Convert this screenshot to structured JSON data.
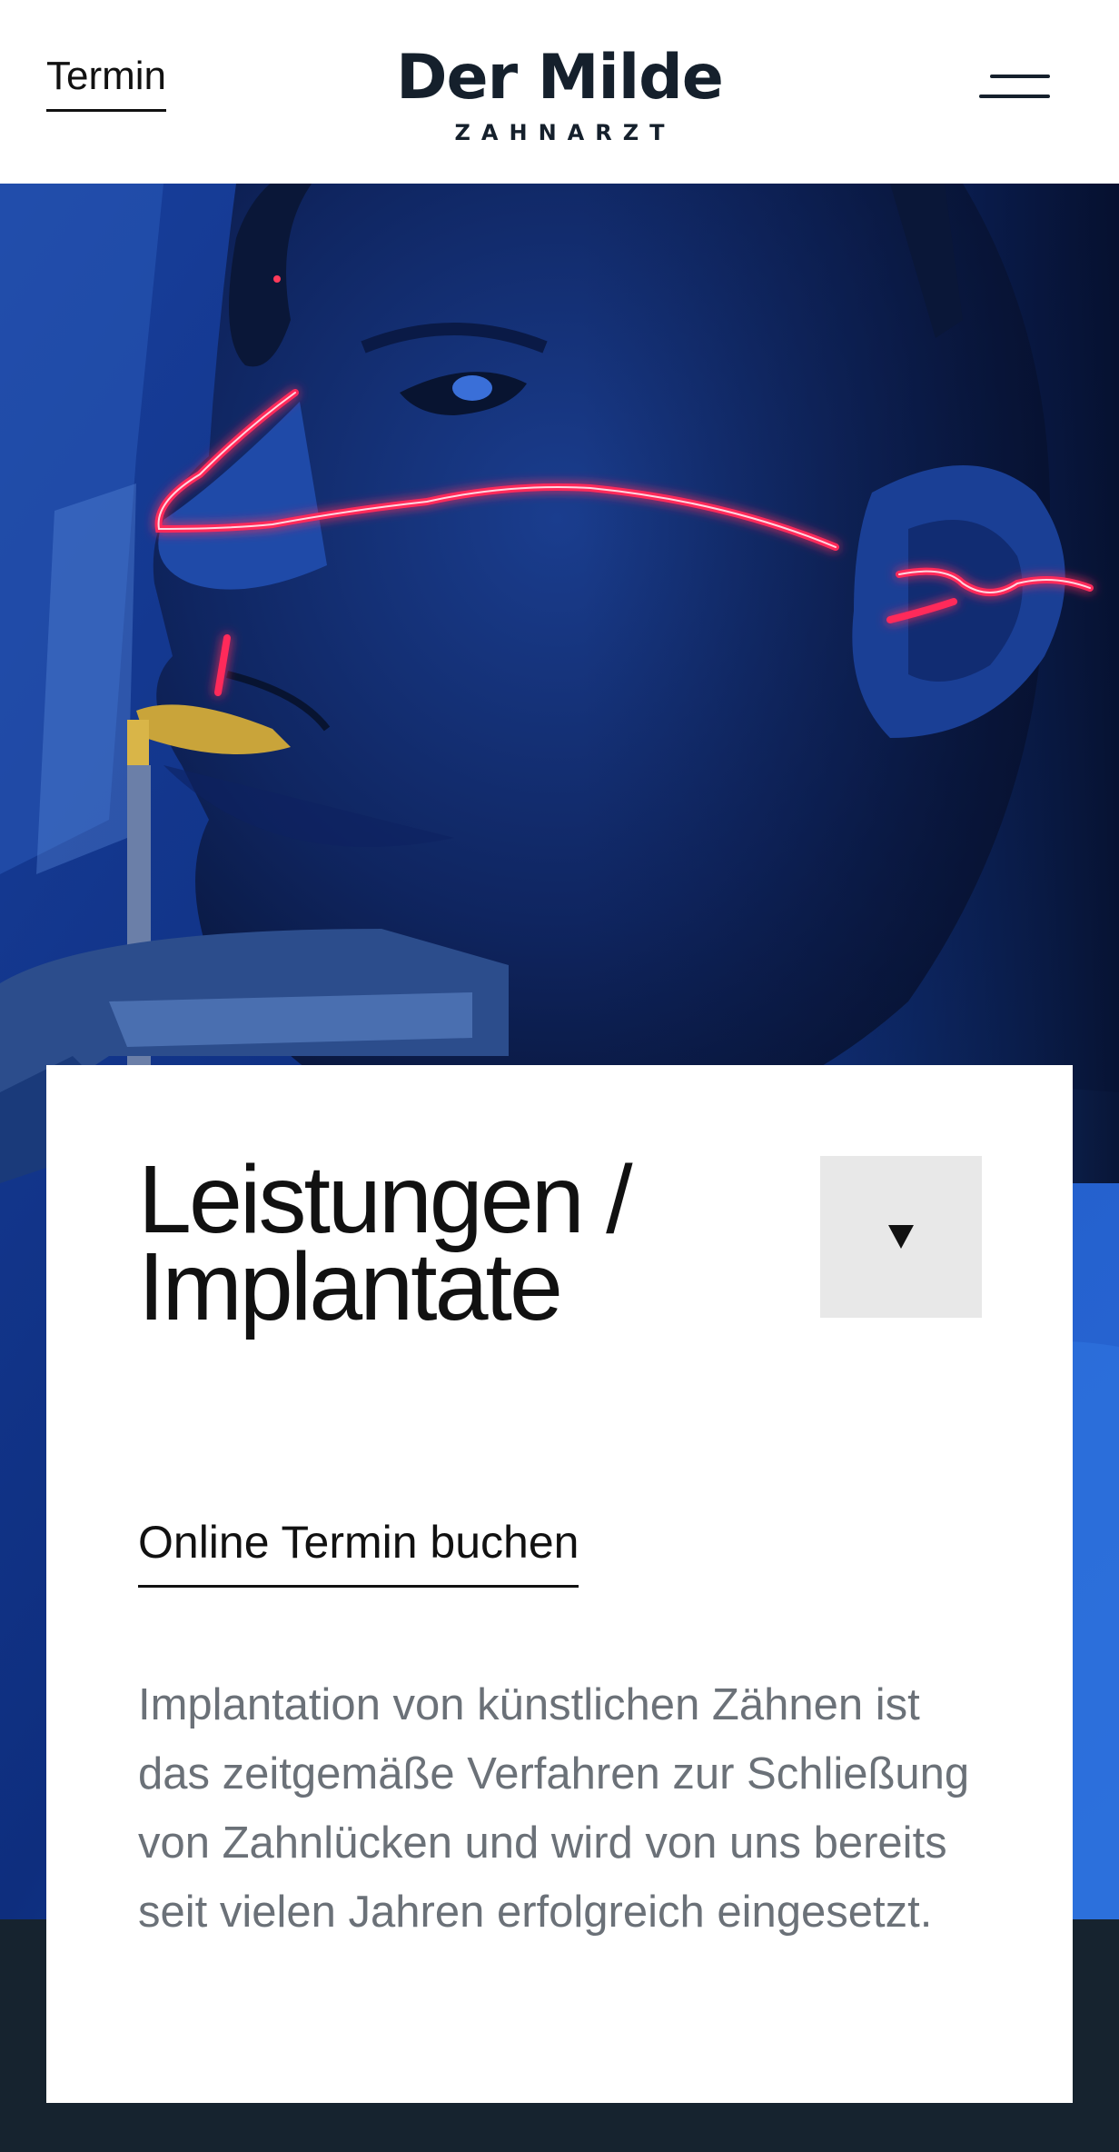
{
  "header": {
    "termin_label": "Termin",
    "logo_name": "Der Milde",
    "logo_subtitle": "ZAHNARZT",
    "menu_icon": "hamburger-menu-icon"
  },
  "hero": {
    "image": "patient-face-laser-scan-photo"
  },
  "card": {
    "title_line1": "Leistungen /",
    "title_line2": "Implantate",
    "dropdown_icon": "triangle-down-icon",
    "booking_link": "Online Termin buchen",
    "description": "Implantation von künstlichen Zähnen ist das zeitgemäße Verfahren zur Schließung von Zahnlücken und wird von uns bereits seit vielen Jahren erfolgreich eingesetzt."
  },
  "colors": {
    "brand_dark": "#15202c",
    "footer_band": "#16232f",
    "hero_blue": "#1f5fd0",
    "laser_red": "#ff2a5a",
    "dropdown_bg": "#e8e8e8",
    "body_text": "#6b7178"
  }
}
